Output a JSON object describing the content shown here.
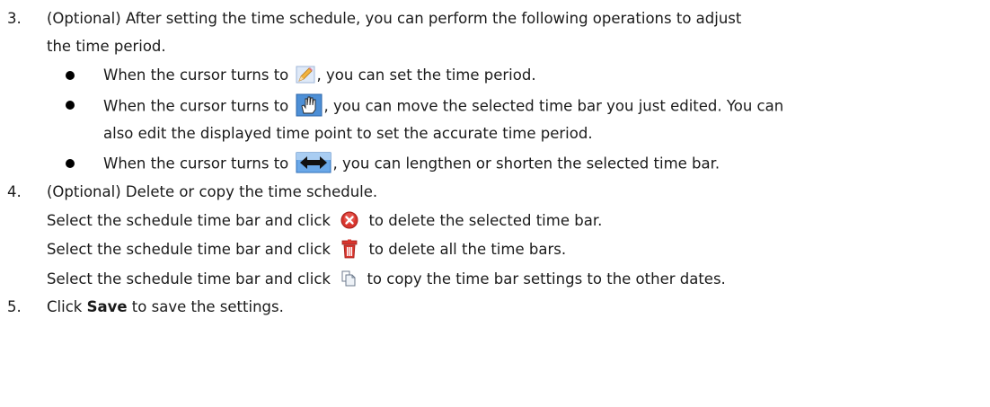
{
  "steps": {
    "s3": {
      "num": "3.",
      "line1": "(Optional) After setting the time schedule, you can perform the following operations to adjust",
      "line2": "the time period.",
      "b1": {
        "pre": "When the cursor turns to",
        "post": ", you can set the time period.",
        "icon": "pencil-icon"
      },
      "b2": {
        "pre": "When the cursor turns to",
        "post": ", you can move the selected time bar you just edited. You can",
        "line2": "also edit the displayed time point to set the accurate time period.",
        "icon": "hand-move-icon"
      },
      "b3": {
        "pre": "When the cursor turns to",
        "post": ", you can lengthen or shorten the selected time bar.",
        "icon": "resize-arrows-icon"
      }
    },
    "s4": {
      "num": "4.",
      "title": "(Optional) Delete or copy the time schedule.",
      "p1": {
        "pre": "Select the schedule time bar and click",
        "post": "to delete the selected time bar.",
        "icon": "delete-circle-icon"
      },
      "p2": {
        "pre": "Select the schedule time bar and click",
        "post": "to delete all the time bars.",
        "icon": "trash-icon"
      },
      "p3": {
        "pre": "Select the schedule time bar and click",
        "post": "to copy the time bar settings to the other dates.",
        "icon": "copy-icon"
      }
    },
    "s5": {
      "num": "5.",
      "pre": "Click",
      "bold": "Save",
      "post": "to save the settings."
    }
  },
  "colors": {
    "text": "#1a1a1a",
    "delete_red": "#d9352e",
    "resize_blue": "#1f5fbf"
  }
}
